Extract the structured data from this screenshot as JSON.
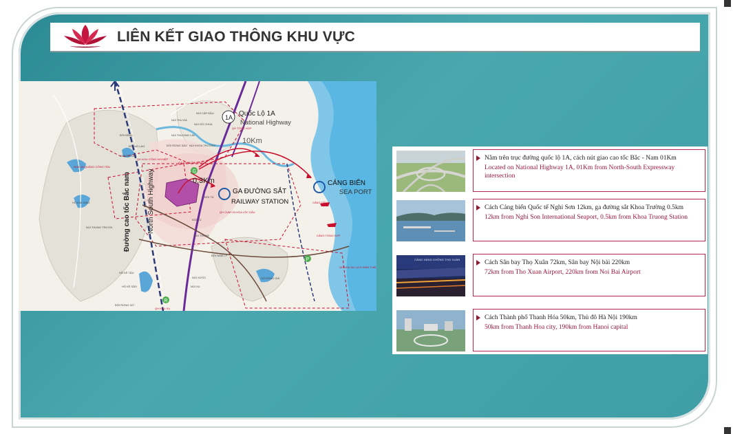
{
  "header": {
    "title": "LIÊN KẾT GIAO THÔNG KHU VỰC"
  },
  "map": {
    "route_badge": "1A",
    "highway_vn": "Quốc Lộ 1A",
    "highway_en": "National Highway",
    "distance_highway": "10Km",
    "distance_station": "0,3Km",
    "station_vn": "GA ĐƯỜNG SẮT",
    "station_en": "RAILWAY STATION",
    "seaport_vn": "CẢNG BIỂN",
    "seaport_en": "SEA PORT",
    "expressway_vn": "Đường cao tốc Bắc nam",
    "expressway_en": "North South Highway",
    "small_labels": {
      "cang_dau": "CẢNG DẦU",
      "cang_tong_hop": "CẢNG TỔNG HỢP",
      "ga_khoa_truong": "GA KHOA TRƯỜNG",
      "qh_cum_cn": "QH CỤM CN HÓA LỘC DẦU",
      "qh_khu_du_lich": "QH KHU DU LỊCH SINH THÁI",
      "qh_khu_cong_nghiep": "QH KHU CÔNG NGHIỆP",
      "qh_tong_hop": "QH TỔNG HỢP",
      "qh_khu_xu": "QH KHU XU",
      "nha_xa_quang": "NHÀ XA QUẢNG CÔNG TÂN",
      "ho_kim_giao": "HỒ KIM GIAO",
      "nui_thung_truon": "NÚI THUNG TRƯƠN",
      "nui_thung": "NÚI THUNG",
      "ho_ke_tau": "HỒ KÈ TẬU",
      "ho_ke_sao": "HỒ KÈ SÃO",
      "doi_rung_327": "ĐỒI RỪNG 327",
      "ho_dong_gia": "HỒ ĐỒNG GIÁ",
      "doi_ng_lao": "ĐỒI NG LAO",
      "nui_thu_da": "NÚI THU ĐÀ",
      "nui_go_chua": "NÚI GÒ CHÙA",
      "nui_cap_dau": "NÚI CÁP ĐẦU",
      "nui_khoa_truong": "NÚI KHOA TRƯỜNG",
      "nui_xuoc": "NÚI XƯỚC",
      "doi_tu": "ĐỒI TÚ",
      "doi_tu_2": "ĐỒI TÚ",
      "nui_thuong_lim": "NÚI THƯỢNG LIM",
      "doi_rung_sao": "ĐỒI RỪNG SÁO",
      "doi_dinh": "ĐỒI ĐỈNH",
      "doi_nam_ly": "ĐỒI NAM LÝ",
      "nui_xu": "NÚI XU",
      "doi_ng_lao_2": "ĐỒI NG LAO"
    },
    "markers": {
      "g": "G",
      "p": "P",
      "r": "R"
    }
  },
  "info": [
    {
      "vn": "Nằm trên trục đường quốc lộ 1A, cách nút giao cao tốc Bắc - Nam 01Km",
      "en": "Located on National Highway 1A, 01Km from North-South Expressway intersection"
    },
    {
      "vn": "Cách Cảng biển Quốc tế Nghi Sơn 12km, ga đường sắt Khoa Trường 0.5km",
      "en": "12km from Nghi Son International Seaport, 0.5km from Khoa Truong Station"
    },
    {
      "vn": "Cách Sân bay Thọ Xuân 72km, Sân bay Nội bài 220km",
      "en": "72km from Tho Xuan Airport, 220km from Noi Bai Airport"
    },
    {
      "vn": "Cách Thành phố Thanh Hóa 50km, Thủ đô Hà Nội 190km",
      "en": "50km from Thanh Hoa city, 190km from Hanoi capital"
    }
  ],
  "photos": {
    "airport_sign": "CẢNG HÀNG KHÔNG THỌ XUÂN"
  },
  "colors": {
    "teal": "#3f9ea6",
    "accent": "#a0163a",
    "lotus": "#c4163f"
  }
}
